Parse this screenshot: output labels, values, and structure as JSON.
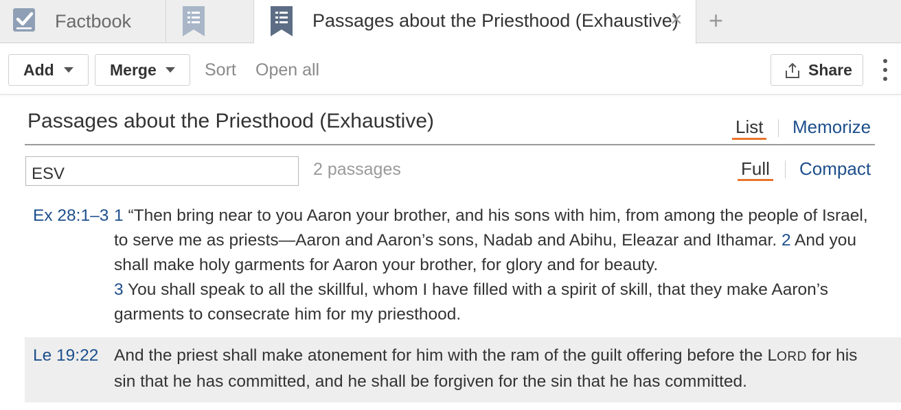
{
  "tabs": {
    "factbook_label": "Factbook",
    "active_label": "Passages about the Priesthood (Exhaustive)",
    "close_glyph": "×",
    "new_tab_glyph": "+"
  },
  "toolbar": {
    "add_label": "Add",
    "merge_label": "Merge",
    "sort_label": "Sort",
    "open_all_label": "Open all",
    "share_label": "Share"
  },
  "document": {
    "title": "Passages about the Priesthood (Exhaustive)",
    "view_tabs": {
      "list": "List",
      "memorize": "Memorize"
    },
    "display_tabs": {
      "full": "Full",
      "compact": "Compact"
    },
    "version_value": "ESV",
    "passage_count": "2 passages"
  },
  "passages": [
    {
      "ref": "Ex 28:1–3",
      "verses": [
        {
          "num": "1",
          "text": " “Then bring near to you Aaron your brother, and his sons with him, from among the people of Israel, to serve me as priests—Aaron and Aaron’s sons, Nadab and Abihu, Eleazar and Ithamar. "
        },
        {
          "num": "2",
          "text": " And you shall make holy garments for Aaron your brother, for glory and for beauty. "
        },
        {
          "num": "3",
          "text": " You shall speak to all the skillful, whom I have filled with a spirit of skill, that they make Aaron’s garments to consecrate him for my priesthood."
        }
      ]
    },
    {
      "ref": "Le 19:22",
      "text_before": "And the priest shall make atonement for him with the ram of the guilt offering before the ",
      "lord_initial": "L",
      "lord_rest": "ORD",
      "text_after": " for his sin that he has committed, and he shall be forgiven for the sin that he has committed."
    }
  ],
  "colors": {
    "link_blue": "#1d4f8c",
    "accent_orange": "#e8732b",
    "icon_slate": "#8f9fb5",
    "icon_slate_dark": "#5d6d85"
  },
  "icons": [
    "checklist-icon",
    "bookmark-list-icon",
    "share-icon",
    "more-vertical-icon",
    "chevron-down-icon"
  ]
}
